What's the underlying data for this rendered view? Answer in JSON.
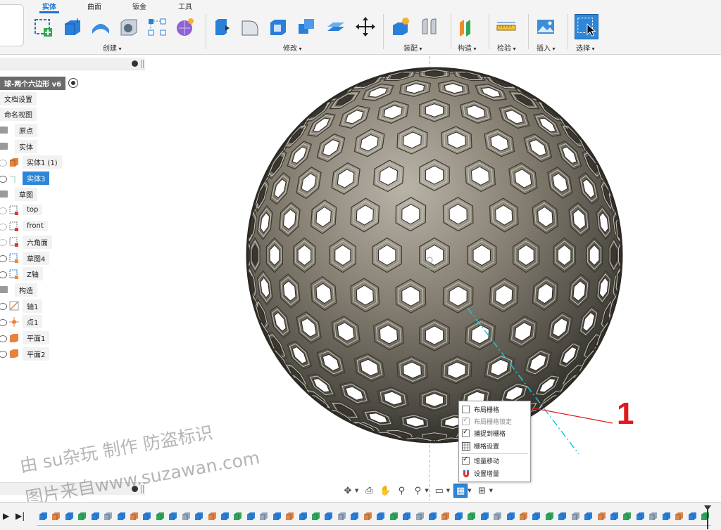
{
  "ribbon": {
    "tabs": [
      "实体",
      "曲面",
      "钣金",
      "工具"
    ],
    "active_tab": "实体",
    "groups": [
      "创建",
      "修改",
      "装配",
      "构造",
      "检验",
      "插入",
      "选择"
    ]
  },
  "tree": {
    "document_title": "球-两个六边形 v6",
    "items": [
      {
        "label": "文档设置",
        "kind": "node"
      },
      {
        "label": "命名视图",
        "kind": "node"
      },
      {
        "label": "原点",
        "kind": "folder"
      },
      {
        "label": "实体",
        "kind": "folder"
      },
      {
        "label": "实体1 (1)",
        "kind": "body",
        "visible": false
      },
      {
        "label": "实体3",
        "kind": "body",
        "visible": true,
        "selected": true
      },
      {
        "label": "草图",
        "kind": "folder"
      },
      {
        "label": "top",
        "kind": "sketch",
        "visible": false
      },
      {
        "label": "front",
        "kind": "sketch",
        "visible": false
      },
      {
        "label": "六角面",
        "kind": "sketch",
        "visible": false
      },
      {
        "label": "草图4",
        "kind": "sketch",
        "visible": true
      },
      {
        "label": "Z轴",
        "kind": "sketch",
        "visible": true
      },
      {
        "label": "构造",
        "kind": "folder"
      },
      {
        "label": "轴1",
        "kind": "axis",
        "visible": true
      },
      {
        "label": "点1",
        "kind": "point",
        "visible": true
      },
      {
        "label": "平面1",
        "kind": "plane",
        "visible": true
      },
      {
        "label": "平面2",
        "kind": "plane",
        "visible": true
      }
    ]
  },
  "grid_menu": {
    "items": [
      {
        "label": "布局栅格",
        "checked": false,
        "disabled": false
      },
      {
        "label": "布局栅格锁定",
        "checked": true,
        "disabled": true
      },
      {
        "label": "捕捉到栅格",
        "checked": true,
        "disabled": false
      },
      {
        "label": "栅格设置",
        "icon": "grid-icon"
      },
      {
        "label": "增量移动",
        "checked": true,
        "disabled": false
      },
      {
        "label": "设置增量",
        "icon": "magnet-icon"
      }
    ]
  },
  "annotation": {
    "number": "1",
    "color": "#e0191e"
  },
  "watermark": {
    "line1": "由 su杂玩 制作 防盗标识",
    "line2": "图片来自www.suzawan.com"
  },
  "colors": {
    "accent": "#1e6fd0",
    "selection": "#2e86d6",
    "annotation": "#e0191e"
  }
}
